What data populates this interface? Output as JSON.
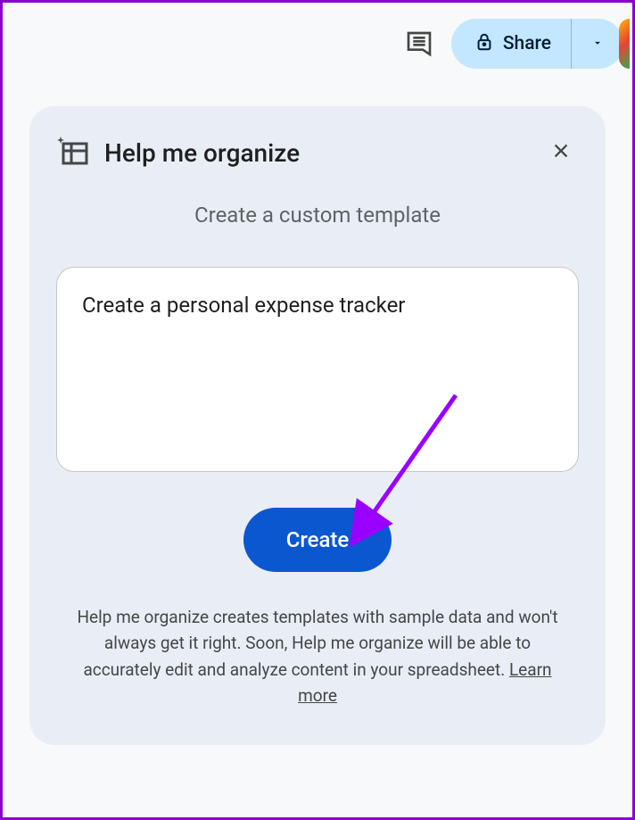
{
  "toolbar": {
    "share_label": "Share"
  },
  "panel": {
    "title": "Help me organize",
    "subtitle": "Create a custom template",
    "prompt_value": "Create a personal expense tracker",
    "create_label": "Create",
    "description_text": "Help me organize creates templates with sample data and won't always get it right. Soon, Help me organize will be able to accurately edit and analyze content in your spreadsheet. ",
    "learn_more_label": "Learn more"
  }
}
